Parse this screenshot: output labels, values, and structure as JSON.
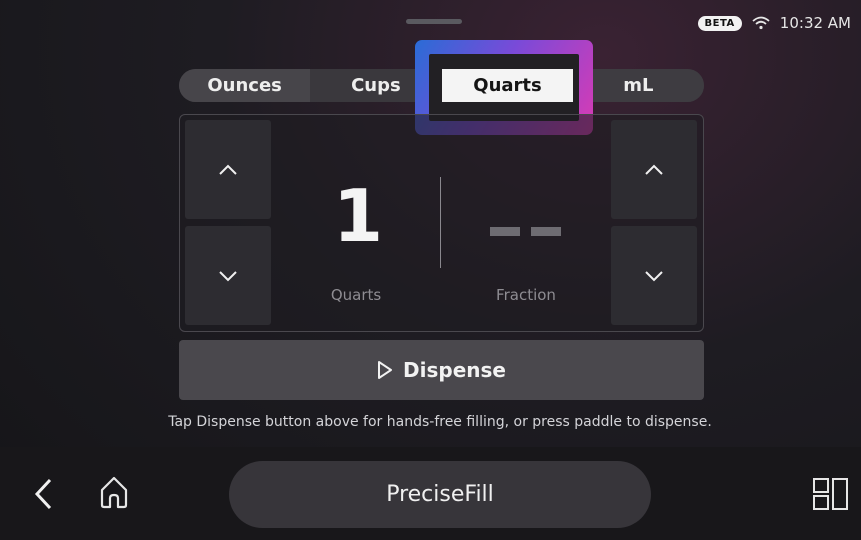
{
  "status": {
    "badge": "BETA",
    "time": "10:32 AM"
  },
  "units": {
    "tabs": [
      "Ounces",
      "Cups",
      "Quarts",
      "mL"
    ],
    "selected": "Quarts"
  },
  "amount": {
    "whole": "1",
    "whole_label": "Quarts",
    "fraction": "--",
    "fraction_label": "Fraction"
  },
  "dispense": {
    "label": "Dispense"
  },
  "hint": "Tap Dispense button above for hands-free filling, or press paddle to dispense.",
  "nav": {
    "app_title": "PreciseFill"
  },
  "colors": {
    "highlight_start": "#2a6cd6",
    "highlight_end": "#d93bb4",
    "selected_tab": "#f4f4f4"
  }
}
